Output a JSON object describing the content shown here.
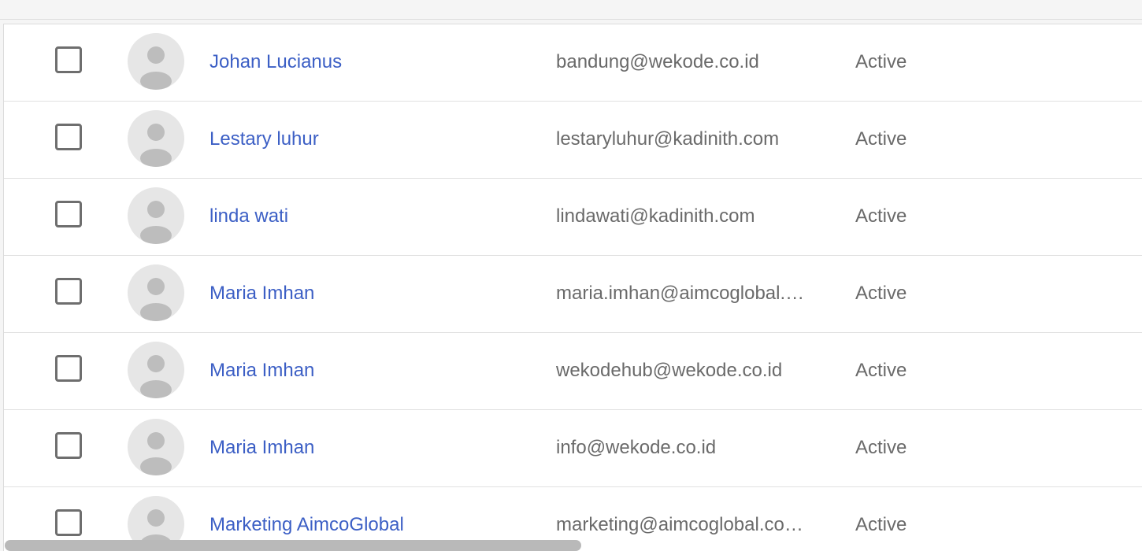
{
  "users": [
    {
      "name": "Johan Lucianus",
      "email": "bandung@wekode.co.id",
      "status": "Active"
    },
    {
      "name": "Lestary luhur",
      "email": "lestaryluhur@kadinith.com",
      "status": "Active"
    },
    {
      "name": "linda wati",
      "email": "lindawati@kadinith.com",
      "status": "Active"
    },
    {
      "name": "Maria Imhan",
      "email": "maria.imhan@aimcoglobal.…",
      "status": "Active"
    },
    {
      "name": "Maria Imhan",
      "email": "wekodehub@wekode.co.id",
      "status": "Active"
    },
    {
      "name": "Maria Imhan",
      "email": "info@wekode.co.id",
      "status": "Active"
    },
    {
      "name": "Marketing AimcoGlobal",
      "email": "marketing@aimcoglobal.co…",
      "status": "Active"
    }
  ],
  "colors": {
    "link": "#3c5fc5",
    "text_secondary": "#6a6a6a",
    "avatar_bg": "#e6e6e6",
    "avatar_fg": "#bdbdbd",
    "scroll_thumb": "#b9b9b9"
  },
  "icons": {
    "avatar": "default-person-icon",
    "checkbox": "unchecked-checkbox"
  }
}
